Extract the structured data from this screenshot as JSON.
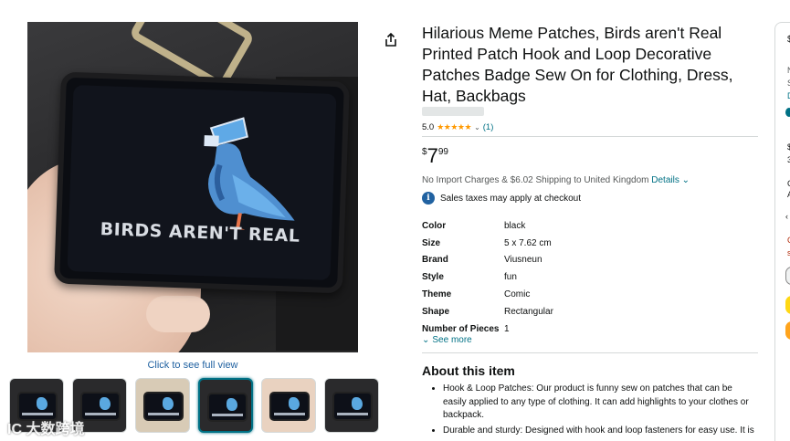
{
  "product": {
    "title": "Hilarious Meme Patches, Birds aren't Real Printed Patch Hook and Loop Decorative Patches Badge Sew On for Clothing, Dress, Hat, Backbags",
    "image_text": "BIRDS AREN'T REAL",
    "click_full_view": "Click to see full view",
    "rating_value": "5.0",
    "stars": "★★★★★",
    "rating_count": "(1)",
    "price_symbol": "$",
    "price_whole": "7",
    "price_fraction": "99",
    "shipping_text": "No Import Charges & $6.02 Shipping to United Kingdom",
    "shipping_details": "Details",
    "tax_text": "Sales taxes may apply at checkout",
    "see_more": "See more",
    "about_title": "About this item"
  },
  "specs": [
    {
      "key": "Color",
      "value": "black"
    },
    {
      "key": "Size",
      "value": "5 x 7.62 cm"
    },
    {
      "key": "Brand",
      "value": "Viusneun"
    },
    {
      "key": "Style",
      "value": "fun"
    },
    {
      "key": "Theme",
      "value": "Comic"
    },
    {
      "key": "Shape",
      "value": "Rectangular"
    },
    {
      "key": "Number of Pieces",
      "value": "1"
    }
  ],
  "bullets": [
    "Hook & Loop Patches: Our product is funny sew on patches that can be easily applied to any type of clothing. It can add highlights to your clothes or backpack.",
    "Durable and sturdy: Designed with hook and loop fasteners for easy use. It is"
  ],
  "icons": {
    "share": "share-icon",
    "info": "info-icon",
    "chevron": "chevron-down-icon"
  },
  "buybox_fragments": [
    "$",
    "N",
    "S",
    "D",
    "$",
    "3",
    "C",
    "A",
    "C",
    "s"
  ],
  "watermark": "IC 大数跨境",
  "colors": {
    "link": "#007185",
    "star": "#ff9900",
    "accent": "#2162a1"
  }
}
